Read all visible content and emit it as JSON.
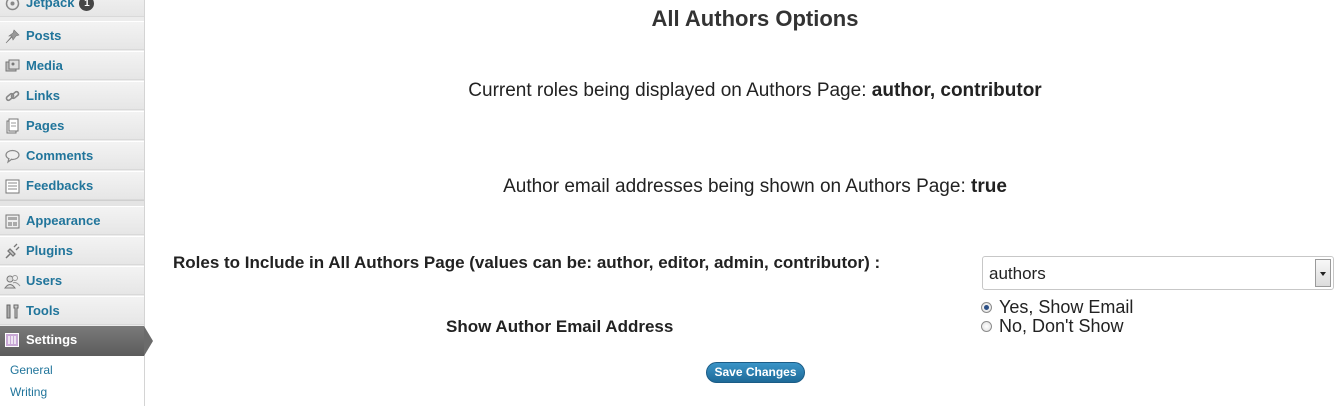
{
  "sidebar": {
    "top_item": {
      "label": "Jetpack",
      "badge": "1"
    },
    "items": [
      {
        "label": "Posts"
      },
      {
        "label": "Media"
      },
      {
        "label": "Links"
      },
      {
        "label": "Pages"
      },
      {
        "label": "Comments"
      },
      {
        "label": "Feedbacks"
      },
      {
        "label": "Appearance"
      },
      {
        "label": "Plugins"
      },
      {
        "label": "Users"
      },
      {
        "label": "Tools"
      },
      {
        "label": "Settings"
      }
    ],
    "submenu": [
      {
        "label": "General"
      },
      {
        "label": "Writing"
      }
    ]
  },
  "main": {
    "title": "All Authors Options",
    "roles_line_prefix": "Current roles being displayed on Authors Page:",
    "roles_line_value": "author, contributor",
    "email_line_prefix": "Author email addresses being shown on Authors Page:",
    "email_line_value": "true",
    "roles_field_label": "Roles to Include in All Authors Page (values can be: author, editor, admin, contributor) :",
    "roles_field_value": "authors",
    "email_field_label": "Show Author Email Address",
    "radio_yes": "Yes, Show Email",
    "radio_no": "No, Don't Show",
    "save_label": "Save Changes"
  }
}
